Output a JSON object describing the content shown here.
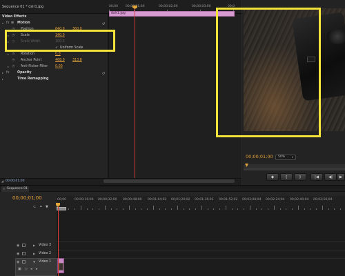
{
  "effect_controls": {
    "sequence_title": "Sequence 01 * dslr1.jpg",
    "ruler_labels": [
      "00;00",
      "00;00;01;00",
      "00;00;02;00",
      "00;00;03;00",
      "00;0"
    ],
    "clip_name": "dslr1.jpg",
    "section_header": "Video Effects",
    "motion": {
      "label": "Motion",
      "position_label": "Position",
      "position_x": "640.0",
      "position_y": "360.0",
      "scale_label": "Scale",
      "scale_value": "140.0",
      "scale_width_label": "Scale Width",
      "scale_width_value": "100.0",
      "uniform_scale_label": "Uniform Scale",
      "uniform_scale_checked": true,
      "rotation_label": "Rotation",
      "rotation_value": "0.0",
      "anchor_label": "Anchor Point",
      "anchor_x": "468.0",
      "anchor_y": "313.8",
      "antiflicker_label": "Anti-flicker Filter",
      "antiflicker_value": "0.00"
    },
    "opacity_label": "Opacity",
    "time_remapping_label": "Time Remapping",
    "footer_timecode": "00;00;01;00"
  },
  "program_monitor": {
    "timecode": "00;00;01;00",
    "zoom": "50%",
    "buttons": [
      "◆",
      "{",
      "}",
      "|◀",
      "◀|",
      "▶",
      "|▶"
    ]
  },
  "sequence": {
    "tab_label": "Sequence 01",
    "timecode": "00;00;01;00",
    "ruler_labels": [
      "00;00",
      "00;00;16;00",
      "00;00;32;00",
      "00;00;48;00",
      "00;01;04;02",
      "00;01;20;02",
      "00;01;36;02",
      "00;01;52;02",
      "00;02;08;04",
      "00;02;24;04",
      "00;02;40;04",
      "00;02;56;04"
    ],
    "tracks": [
      {
        "name": "Video 3"
      },
      {
        "name": "Video 2"
      },
      {
        "name": "Video 1"
      }
    ]
  },
  "colors": {
    "accent_timecode": "#e8a23a",
    "clip_pink": "#d79bd2",
    "playhead": "#d83a3a",
    "annotation": "#f2e23a"
  }
}
